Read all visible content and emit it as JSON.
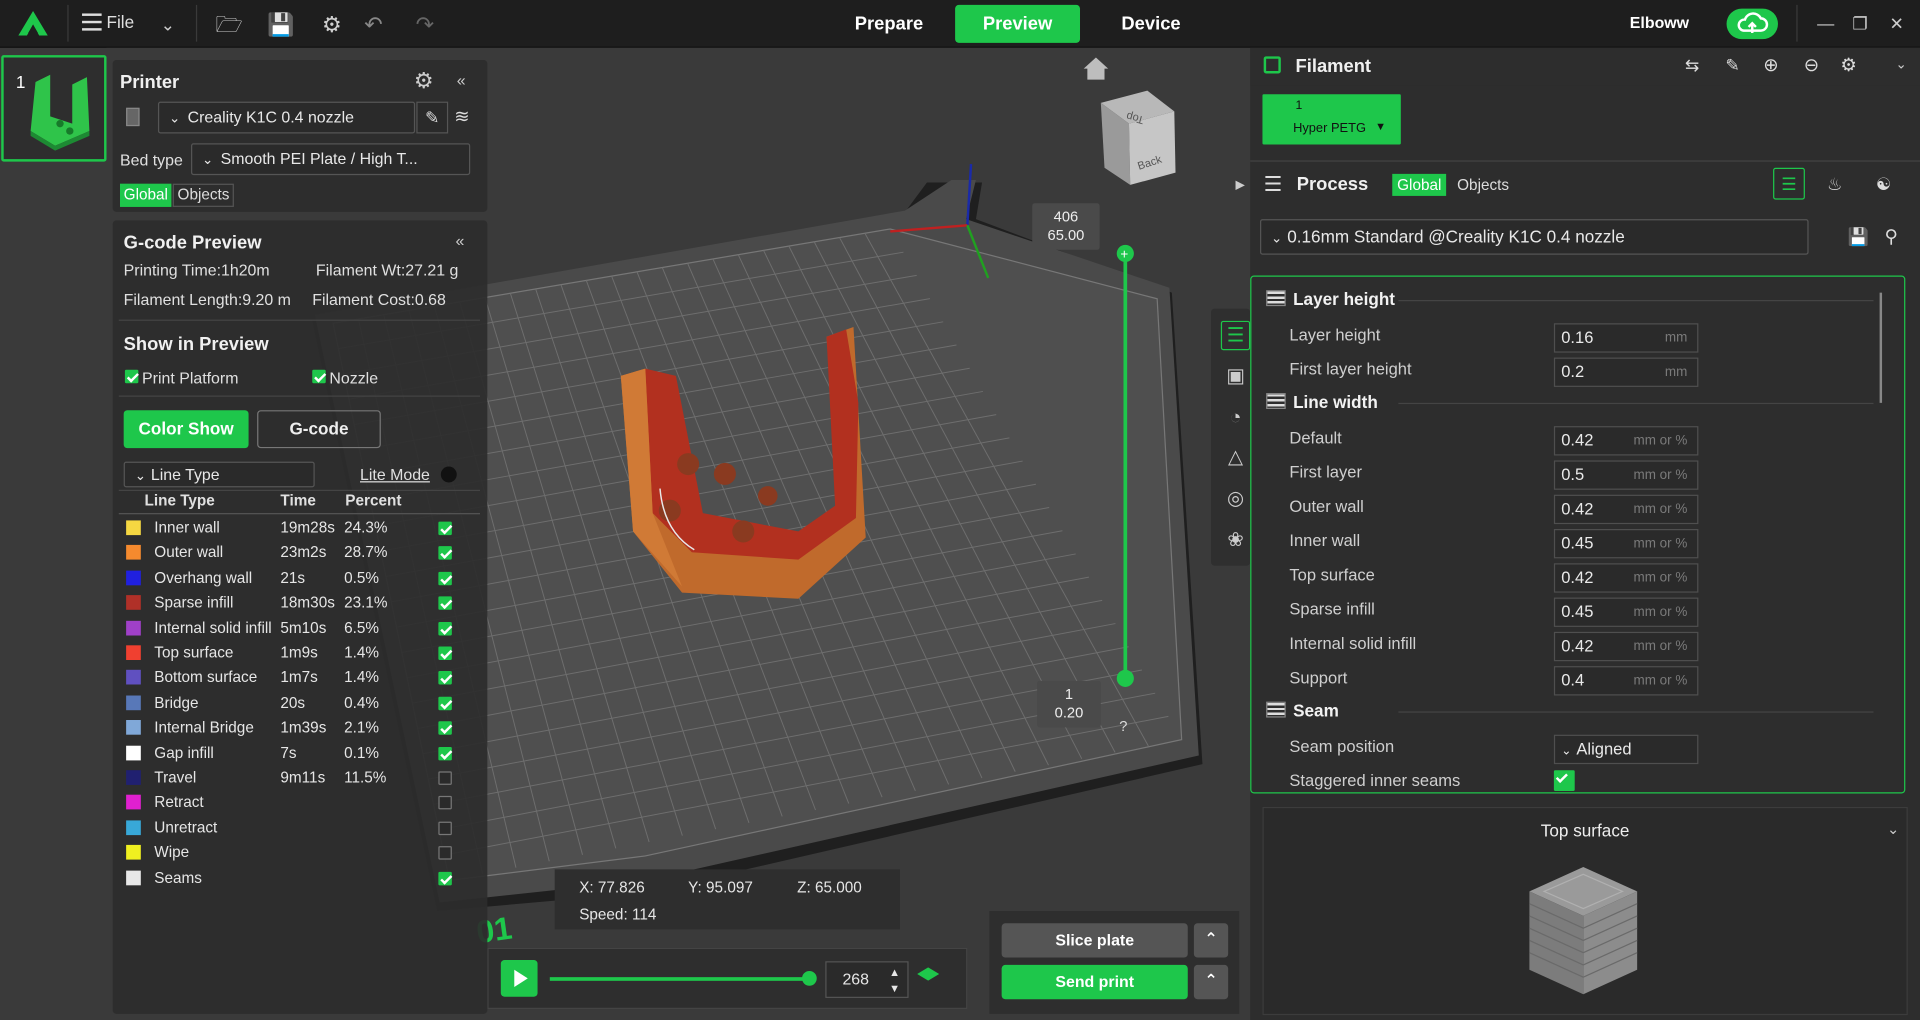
{
  "topbar": {
    "file_label": "File",
    "tabs": [
      "Prepare",
      "Preview",
      "Device"
    ],
    "active_tab": "Preview",
    "username": "Elboww"
  },
  "plate": {
    "number": "1"
  },
  "printer": {
    "title": "Printer",
    "name": "Creality K1C 0.4 nozzle",
    "bed_type_label": "Bed type",
    "bed_type_value": "Smooth PEI Plate / High T...",
    "scope_global": "Global",
    "scope_objects": "Objects"
  },
  "gcode_preview": {
    "title": "G-code Preview",
    "printing_time": "Printing Time:1h20m",
    "filament_wt": "Filament Wt:27.21 g",
    "filament_length": "Filament Length:9.20 m",
    "filament_cost": "Filament Cost:0.68",
    "show_in_preview": "Show in Preview",
    "print_platform": "Print Platform",
    "nozzle": "Nozzle",
    "color_show": "Color Show",
    "gcode": "G-code",
    "view_select": "Line Type",
    "lite_mode": "Lite Mode",
    "columns": [
      "Line Type",
      "Time",
      "Percent"
    ],
    "rows": [
      {
        "name": "Inner wall",
        "time": "19m28s",
        "percent": "24.3%",
        "color": "#f5d742",
        "checked": true
      },
      {
        "name": "Outer wall",
        "time": "23m2s",
        "percent": "28.7%",
        "color": "#f58a2e",
        "checked": true
      },
      {
        "name": "Overhang wall",
        "time": "21s",
        "percent": "0.5%",
        "color": "#2020e0",
        "checked": true
      },
      {
        "name": "Sparse infill",
        "time": "18m30s",
        "percent": "23.1%",
        "color": "#b03028",
        "checked": true
      },
      {
        "name": "Internal solid infill",
        "time": "5m10s",
        "percent": "6.5%",
        "color": "#a040c8",
        "checked": true
      },
      {
        "name": "Top surface",
        "time": "1m9s",
        "percent": "1.4%",
        "color": "#f04030",
        "checked": true
      },
      {
        "name": "Bottom surface",
        "time": "1m7s",
        "percent": "1.4%",
        "color": "#6050c0",
        "checked": true
      },
      {
        "name": "Bridge",
        "time": "20s",
        "percent": "0.4%",
        "color": "#5878b8",
        "checked": true
      },
      {
        "name": "Internal Bridge",
        "time": "1m39s",
        "percent": "2.1%",
        "color": "#80a8d8",
        "checked": true
      },
      {
        "name": "Gap infill",
        "time": "7s",
        "percent": "0.1%",
        "color": "#ffffff",
        "checked": true
      },
      {
        "name": "Travel",
        "time": "9m11s",
        "percent": "11.5%",
        "color": "#202070",
        "checked": false
      },
      {
        "name": "Retract",
        "time": "",
        "percent": "",
        "color": "#e020d0",
        "checked": false
      },
      {
        "name": "Unretract",
        "time": "",
        "percent": "",
        "color": "#38a8d8",
        "checked": false
      },
      {
        "name": "Wipe",
        "time": "",
        "percent": "",
        "color": "#f0f020",
        "checked": false
      },
      {
        "name": "Seams",
        "time": "",
        "percent": "",
        "color": "#e8e8e8",
        "checked": true
      }
    ]
  },
  "viewport": {
    "top_layer": "406",
    "top_height": "65.00",
    "bottom_layer": "1",
    "bottom_height": "0.20",
    "help": "?",
    "x": "X: 77.826",
    "y": "Y: 95.097",
    "z": "Z: 65.000",
    "speed": "Speed: 114",
    "move_value": "268",
    "plate_mark": "01",
    "cube_top": "Top",
    "cube_back": "Back"
  },
  "actions": {
    "slice": "Slice plate",
    "send": "Send print"
  },
  "filament": {
    "title": "Filament",
    "slot_num": "1",
    "slot_name": "Hyper PETG",
    "slot_color": "#1ec74b"
  },
  "process": {
    "title": "Process",
    "scope_global": "Global",
    "scope_objects": "Objects",
    "preset": "0.16mm Standard @Creality K1C 0.4 nozzle",
    "sections": [
      {
        "title": "Layer height",
        "rows": [
          {
            "label": "Layer height",
            "value": "0.16",
            "unit": "mm"
          },
          {
            "label": "First layer height",
            "value": "0.2",
            "unit": "mm"
          }
        ]
      },
      {
        "title": "Line width",
        "rows": [
          {
            "label": "Default",
            "value": "0.42",
            "unit": "mm or %"
          },
          {
            "label": "First layer",
            "value": "0.5",
            "unit": "mm or %"
          },
          {
            "label": "Outer wall",
            "value": "0.42",
            "unit": "mm or %"
          },
          {
            "label": "Inner wall",
            "value": "0.45",
            "unit": "mm or %"
          },
          {
            "label": "Top surface",
            "value": "0.42",
            "unit": "mm or %"
          },
          {
            "label": "Sparse infill",
            "value": "0.45",
            "unit": "mm or %"
          },
          {
            "label": "Internal solid infill",
            "value": "0.42",
            "unit": "mm or %"
          },
          {
            "label": "Support",
            "value": "0.4",
            "unit": "mm or %"
          }
        ]
      },
      {
        "title": "Seam",
        "rows": [
          {
            "label": "Seam position",
            "value": "Aligned",
            "unit": ""
          },
          {
            "label": "Staggered inner seams",
            "value": "",
            "unit": ""
          }
        ]
      }
    ]
  },
  "help_panel": {
    "title": "Top surface"
  }
}
